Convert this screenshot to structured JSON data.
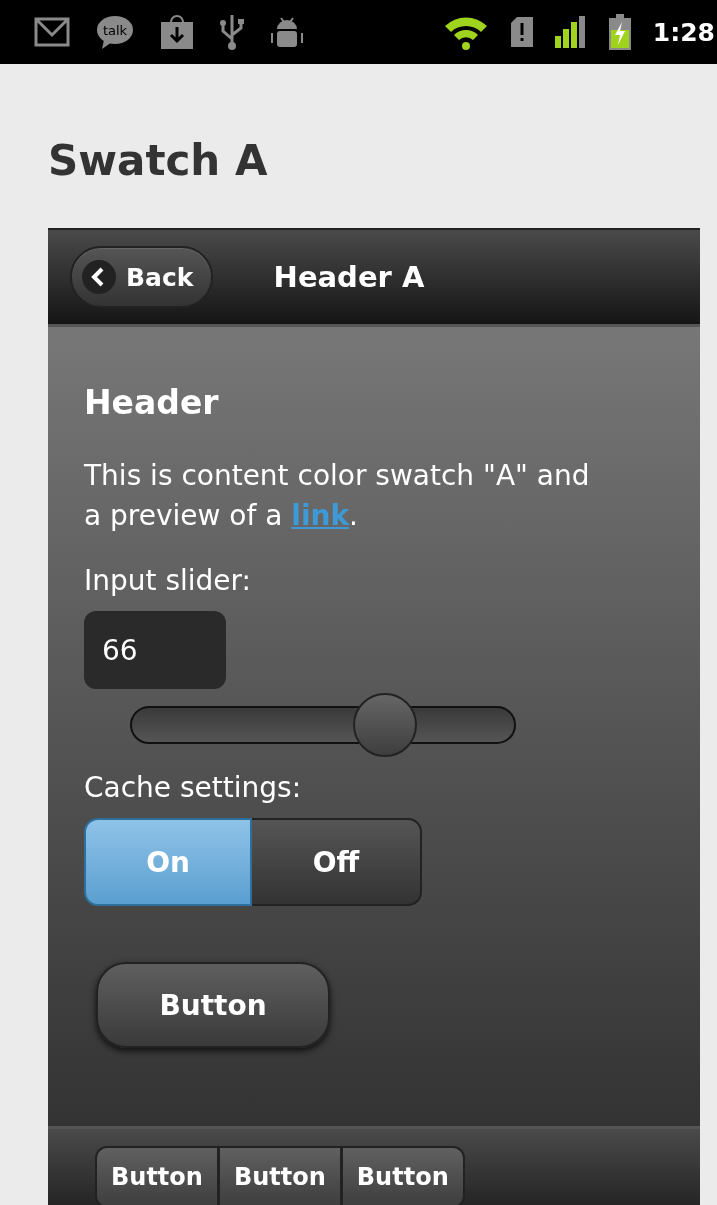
{
  "status_bar": {
    "talk_label": "talk",
    "time": "1:28"
  },
  "title": "Swatch A",
  "header": {
    "back_label": "Back",
    "title": "Header A"
  },
  "content": {
    "heading": "Header",
    "paragraph": "This is content color swatch \"A\" and a preview of a",
    "link": "link",
    "paragraph_end": ".",
    "slider": {
      "label": "Input slider:",
      "value": "66",
      "level": 0.66
    },
    "cache": {
      "label": "Cache settings:",
      "options": [
        {
          "label": "On",
          "selected": true
        },
        {
          "label": "Off",
          "selected": false
        }
      ]
    },
    "button": "Button"
  },
  "footer": {
    "buttons": [
      "Button",
      "Button",
      "Button"
    ]
  }
}
